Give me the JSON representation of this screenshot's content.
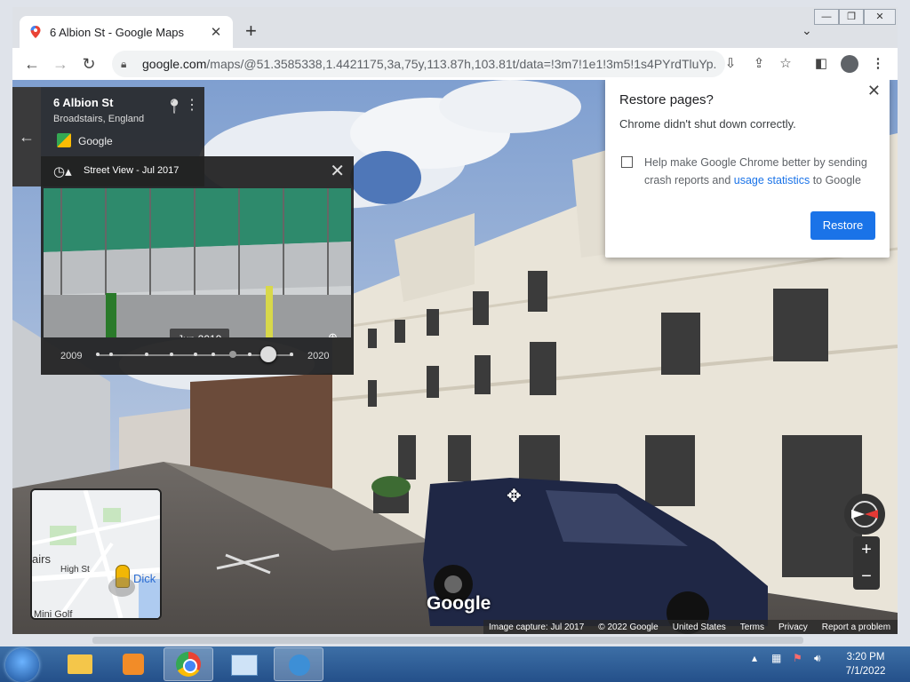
{
  "browser": {
    "tab_title": "6 Albion St - Google Maps",
    "tab_close": "✕",
    "new_tab": "+",
    "tab_search": "⌄",
    "url_host": "google.com",
    "url_path": "/maps/@51.3585338,1.4421175,3a,75y,113.87h,103.81t/data=!3m7!1e1!3m5!1s4PYrdTluYp...",
    "window_controls": [
      "—",
      "❐",
      "✕"
    ]
  },
  "address_card": {
    "title": "6 Albion St",
    "subtitle": "Broadstairs, England",
    "source": "Google"
  },
  "time_travel": {
    "label": "Street View - Jul 2017",
    "thumb_date": "Jun 2019",
    "year_start": "2009",
    "year_end": "2020",
    "selected_fraction": 0.86
  },
  "restore_popup": {
    "title": "Restore pages?",
    "message": "Chrome didn't shut down correctly.",
    "checkbox_text": "Help make Google Chrome better by sending crash reports and ",
    "checkbox_link": "usage statistics",
    "checkbox_text_end": " to Google",
    "button": "Restore",
    "close": "✕"
  },
  "minimap": {
    "labels": [
      "airs",
      "High St",
      "Dick",
      "Mini Golf"
    ]
  },
  "map_controls": {
    "zoom_in": "+",
    "zoom_out": "−"
  },
  "watermark": "Google",
  "footer": {
    "items": [
      "Image capture: Jul 2017",
      "© 2022 Google",
      "United States",
      "Terms",
      "Privacy",
      "Report a problem"
    ]
  },
  "taskbar": {
    "time": "3:20 PM",
    "date": "7/1/2022"
  }
}
